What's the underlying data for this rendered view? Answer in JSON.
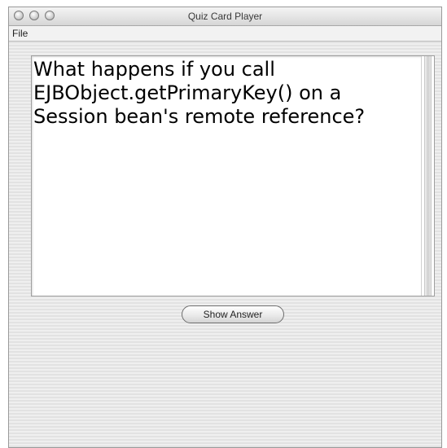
{
  "window": {
    "title": "Quiz Card Player"
  },
  "menu": {
    "items": [
      {
        "label": "File"
      }
    ]
  },
  "card": {
    "question": "What happens if you call EJBObject.getPrimaryKey() on a Session bean's remote reference?"
  },
  "actions": {
    "show_answer_label": "Show Answer"
  }
}
